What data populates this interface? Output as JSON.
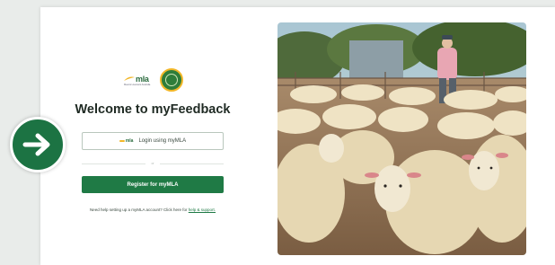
{
  "colors": {
    "brand_green": "#1f7a45",
    "accent_gold": "#f2b728",
    "page_bg": "#e9ecea"
  },
  "logo": {
    "mla_text": "mla",
    "mla_tagline": "Meat & Livestock Australia"
  },
  "title": "Welcome to myFeedback",
  "login_button": {
    "icon": "mla-logo-icon",
    "label": "Login using myMLA"
  },
  "divider_text": "or",
  "register_button": {
    "label": "Register for myMLA"
  },
  "help": {
    "text": "Need help setting up a myMLA account? Click here for",
    "link": "help & support."
  },
  "overlay": {
    "icon": "arrow-right-icon"
  }
}
